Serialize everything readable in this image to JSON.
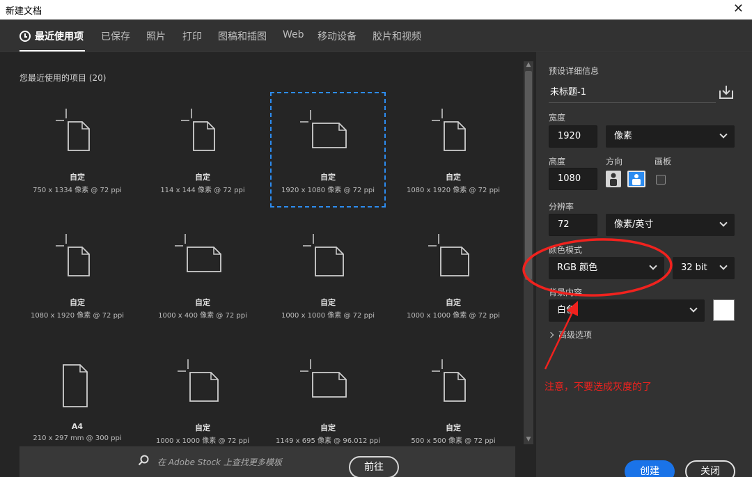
{
  "window": {
    "title": "新建文档",
    "close_glyph": "✕"
  },
  "tabs": [
    {
      "label": "最近使用项",
      "active": true
    },
    {
      "label": "已保存"
    },
    {
      "label": "照片"
    },
    {
      "label": "打印"
    },
    {
      "label": "图稿和插图"
    },
    {
      "label": "Web"
    },
    {
      "label": "移动设备"
    },
    {
      "label": "胶片和视频"
    }
  ],
  "recent": {
    "title": "您最近使用的项目 (20)",
    "items": [
      {
        "name": "自定",
        "size": "750 x 1334 像素 @ 72 ppi",
        "orientation": "portrait"
      },
      {
        "name": "自定",
        "size": "114 x 144 像素 @ 72 ppi",
        "orientation": "portrait"
      },
      {
        "name": "自定",
        "size": "1920 x 1080 像素 @ 72 ppi",
        "orientation": "landscape",
        "selected": true
      },
      {
        "name": "自定",
        "size": "1080 x 1920 像素 @ 72 ppi",
        "orientation": "portrait"
      },
      {
        "name": "自定",
        "size": "1080 x 1920 像素 @ 72 ppi",
        "orientation": "portrait"
      },
      {
        "name": "自定",
        "size": "1000 x 400 像素 @ 72 ppi",
        "orientation": "landscape"
      },
      {
        "name": "自定",
        "size": "1000 x 1000 像素 @ 72 ppi",
        "orientation": "square"
      },
      {
        "name": "自定",
        "size": "1000 x 1000 像素 @ 72 ppi",
        "orientation": "square"
      },
      {
        "name": "A4",
        "size": "210 x 297 mm @ 300 ppi",
        "orientation": "a4"
      },
      {
        "name": "自定",
        "size": "1000 x 1000 像素 @ 72 ppi",
        "orientation": "square"
      },
      {
        "name": "自定",
        "size": "1149 x 695 像素 @ 96.012 ppi",
        "orientation": "landscape"
      },
      {
        "name": "自定",
        "size": "500 x 500 像素 @ 72 ppi",
        "orientation": "portrait"
      }
    ]
  },
  "stock": {
    "placeholder": "在 Adobe Stock 上查找更多模板",
    "go_label": "前往",
    "icon": "search-icon"
  },
  "details": {
    "section_title": "预设详细信息",
    "doc_name": "未标题-1",
    "save_icon": "save-preset-icon",
    "width_label": "宽度",
    "width_value": "1920",
    "width_unit": "像素",
    "height_label": "高度",
    "height_value": "1080",
    "orientation_label": "方向",
    "artboard_label": "画板",
    "resolution_label": "分辨率",
    "resolution_value": "72",
    "resolution_unit": "像素/英寸",
    "color_mode_label": "颜色模式",
    "color_mode_value": "RGB 颜色",
    "bit_depth_value": "32 bit",
    "bg_label": "背景内容",
    "bg_value": "白色",
    "bg_color": "#ffffff",
    "advanced_label": "高级选项"
  },
  "annotation": {
    "text": "注意，不要选成灰度的了",
    "color": "#f0221e"
  },
  "actions": {
    "create_label": "创建",
    "close_label": "关闭"
  }
}
